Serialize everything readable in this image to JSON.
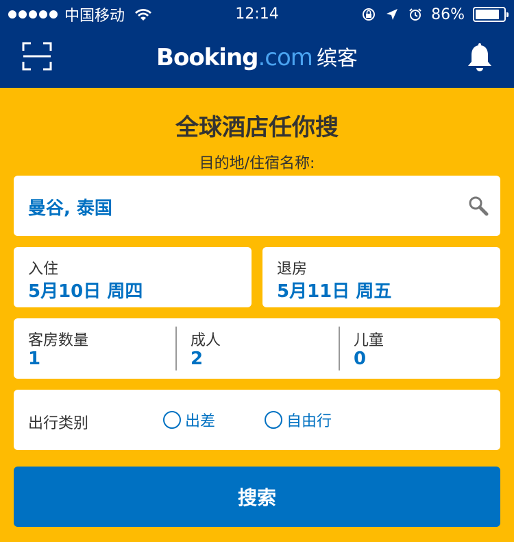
{
  "status_bar": {
    "carrier": "中国移动",
    "time": "12:14",
    "battery": "86%",
    "battery_level": 0.86
  },
  "header": {
    "logo_brand": "Booking",
    "logo_domain": ".com",
    "logo_cn": "缤客"
  },
  "search_form": {
    "headline": "全球酒店任你搜",
    "destination_label": "目的地/住宿名称:",
    "destination_value": "曼谷, 泰国",
    "checkin_label": "入住",
    "checkin_value": "5月10日 周四",
    "checkout_label": "退房",
    "checkout_value": "5月11日 周五",
    "rooms_label": "客房数量",
    "rooms_value": "1",
    "adults_label": "成人",
    "adults_value": "2",
    "children_label": "儿童",
    "children_value": "0",
    "trip_type_label": "出行类别",
    "trip_options": [
      "出差",
      "自由行"
    ],
    "search_button": "搜索"
  },
  "colors": {
    "brand_blue": "#003580",
    "accent_blue": "#0071c2",
    "background_yellow": "#febb02"
  }
}
